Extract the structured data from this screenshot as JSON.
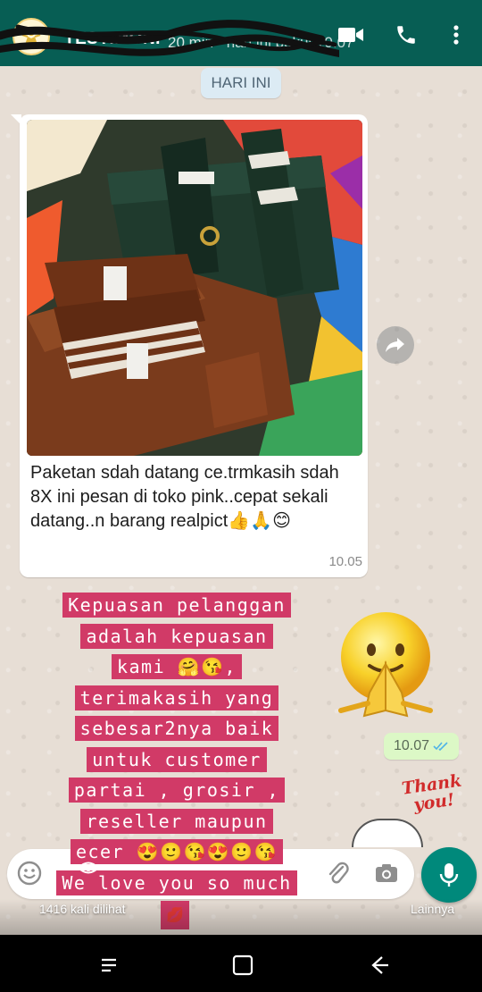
{
  "header": {
    "title": "TESTIMONI",
    "subtitle": "20 min",
    "subtitle_hidden": "hari ini pukul 10.07",
    "bg_color": "#075e54"
  },
  "chat": {
    "date_label": "HARI INI",
    "incoming": {
      "caption": "Paketan sdah datang ce.trmkasih sdah 8X ini pesan di toko pink..cepat sekali datang..n barang realpict👍🙏😊",
      "time": "10.05"
    },
    "outgoing": {
      "time": "10.07",
      "sticker_text": "Thank you!"
    }
  },
  "overlay": {
    "lines": [
      "Kepuasan pelanggan",
      "adalah kepuasan",
      "kami 🤗😘,",
      "terimakasih yang",
      "sebesar2nya baik",
      "untuk customer",
      "partai , grosir ,",
      "reseller maupun",
      "ecer 😍🙂😘😍🙂😘",
      "We love you so much"
    ],
    "lips": "💋",
    "highlight_color": "#d13a67"
  },
  "status": {
    "views": "1416 kali dilihat",
    "more": "Lainnya"
  },
  "icons": {
    "avatar": "avatar-icon",
    "video": "video-call-icon",
    "phone": "phone-icon",
    "menu": "more-vert-icon",
    "forward": "forward-icon",
    "emoji": "emoji-icon",
    "attach": "paperclip-icon",
    "camera": "camera-icon",
    "mic": "mic-icon",
    "eye": "eye-icon",
    "nav_recent": "recent-apps-icon",
    "nav_home": "home-icon",
    "nav_back": "back-icon"
  },
  "colors": {
    "accent": "#00897b",
    "outgoing_bubble": "#dcf8c6",
    "date_pill": "#dcebf4"
  }
}
